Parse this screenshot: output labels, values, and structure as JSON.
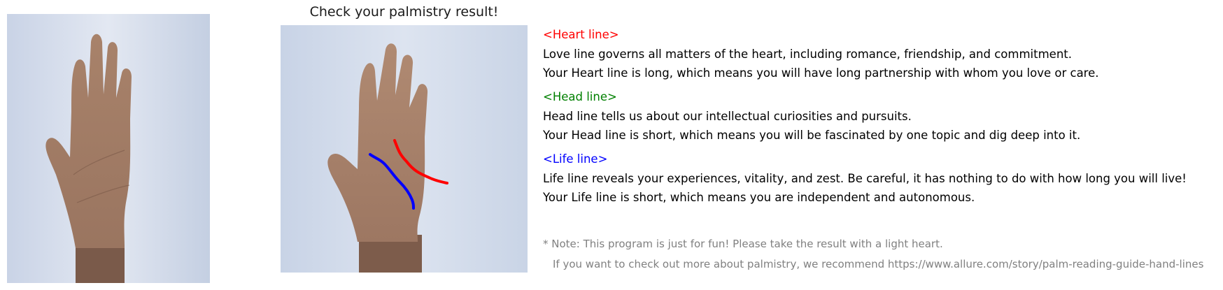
{
  "title": "Check your palmistry result!",
  "colors": {
    "heart_line": "#ff0000",
    "head_line": "#008000",
    "life_line": "#0000ff",
    "note_text": "#808080"
  },
  "heart": {
    "heading": "<Heart line>",
    "desc": "Love line governs all matters of the heart, including romance, friendship, and commitment.",
    "result": "Your Heart line is long, which means you will have long partnership with whom you love or care."
  },
  "head": {
    "heading": "<Head line>",
    "desc": "Head line tells us about our intellectual curiosities and pursuits.",
    "result": "Your Head line is short, which means you will be fascinated by one topic and dig deep into it."
  },
  "life": {
    "heading": "<Life line>",
    "desc": "Life line reveals your experiences, vitality, and zest. Be careful, it has nothing to do with how long you will live!",
    "result": "Your Life line is short, which means you are independent and autonomous."
  },
  "note": {
    "line1": "* Note: This program is just for fun! Please take the result with a light heart.",
    "line2": "If you want to check out more about palmistry, we recommend https://www.allure.com/story/palm-reading-guide-hand-lines"
  }
}
